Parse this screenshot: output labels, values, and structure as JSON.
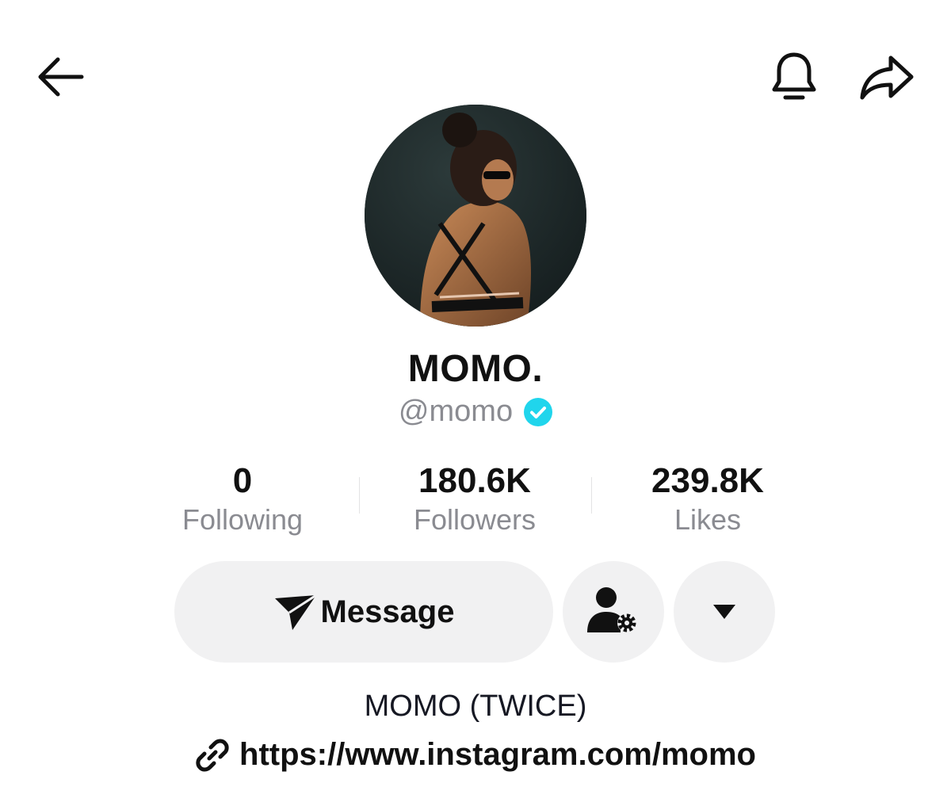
{
  "header": {
    "back_icon": "arrow-left-icon",
    "bell_icon": "bell-icon",
    "share_icon": "share-arrow-icon"
  },
  "profile": {
    "display_name": "MOMO.",
    "handle": "@momo",
    "verified": true,
    "verified_color": "#20d5ec"
  },
  "stats": [
    {
      "value": "0",
      "label": "Following"
    },
    {
      "value": "180.6K",
      "label": "Followers"
    },
    {
      "value": "239.8K",
      "label": "Likes"
    }
  ],
  "actions": {
    "message_label": "Message",
    "message_icon": "send-plane-icon",
    "friend_icon": "user-settings-icon",
    "more_icon": "caret-down-icon"
  },
  "bio": {
    "text": "MOMO (TWICE)",
    "link_icon": "link-icon",
    "link": "https://www.instagram.com/momo"
  }
}
